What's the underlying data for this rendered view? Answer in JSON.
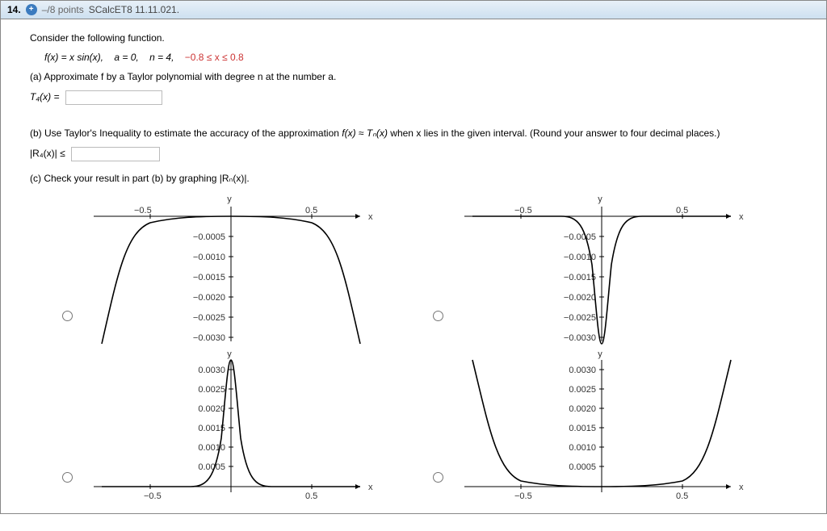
{
  "header": {
    "question_number": "14.",
    "points": "–/8 points",
    "source": "SCalcET8 11.11.021."
  },
  "intro": "Consider the following function.",
  "func": {
    "lhs": "f(x) = x sin(x),",
    "a": "a = 0,",
    "n": "n = 4,",
    "interval": "−0.8 ≤ x ≤ 0.8"
  },
  "part_a": {
    "prompt": "(a) Approximate f by a Taylor polynomial with degree n at the number a.",
    "lhs": "T₄(x) ="
  },
  "part_b": {
    "prompt_pre": "(b) Use Taylor's Inequality to estimate the accuracy of the approximation ",
    "approx": "f(x) ≈ Tₙ(x)",
    "prompt_mid": " when x lies in the given interval. (Round your answer to four decimal places.)",
    "lhs": "|R₄(x)| ≤"
  },
  "part_c": {
    "prompt": "(c) Check your result in part (b) by graphing  |Rₙ(x)|."
  },
  "axis_labels": {
    "x": "x",
    "y": "y"
  },
  "plotA": {
    "x_ticks": [
      "−0.5",
      "0.5"
    ],
    "y_ticks": [
      "−0.0005",
      "−0.0010",
      "−0.0015",
      "−0.0020",
      "−0.0025",
      "−0.0030"
    ]
  },
  "plotB": {
    "x_ticks": [
      "−0.5",
      "0.5"
    ],
    "y_ticks": [
      "−0.0005",
      "−0.0010",
      "−0.0015",
      "−0.0020",
      "−0.0025",
      "−0.0030"
    ]
  },
  "plotC": {
    "x_ticks": [
      "−0.5",
      "0.5"
    ],
    "y_ticks": [
      "0.0030",
      "0.0025",
      "0.0020",
      "0.0015",
      "0.0010",
      "0.0005"
    ]
  },
  "plotD": {
    "x_ticks": [
      "−0.5",
      "0.5"
    ],
    "y_ticks": [
      "0.0030",
      "0.0025",
      "0.0020",
      "0.0015",
      "0.0010",
      "0.0005"
    ]
  },
  "chart_data": [
    {
      "type": "line",
      "title": "Option A",
      "xlabel": "x",
      "ylabel": "y",
      "xlim": [
        -0.8,
        0.8
      ],
      "ylim": [
        -0.0033,
        0.0002
      ],
      "x": [
        -0.8,
        -0.7,
        -0.6,
        -0.5,
        -0.4,
        -0.3,
        -0.2,
        -0.1,
        0,
        0.1,
        0.2,
        0.3,
        0.4,
        0.5,
        0.6,
        0.7,
        0.8
      ],
      "y": [
        -0.0031,
        -0.0014,
        -0.00055,
        -0.00017,
        -4e-05,
        -5e-06,
        0,
        0,
        0,
        0,
        0,
        -5e-06,
        -4e-05,
        -0.00017,
        -0.00055,
        -0.0014,
        -0.0031
      ]
    },
    {
      "type": "line",
      "title": "Option B",
      "xlabel": "x",
      "ylabel": "y",
      "xlim": [
        -0.8,
        0.8
      ],
      "ylim": [
        -0.0033,
        0.0002
      ],
      "x": [
        -0.8,
        -0.6,
        -0.4,
        -0.2,
        -0.1,
        -0.05,
        0,
        0.05,
        0.1,
        0.2,
        0.4,
        0.6,
        0.8
      ],
      "y": [
        0,
        0,
        0,
        -0.00015,
        -0.0008,
        -0.0022,
        -0.0033,
        -0.0022,
        -0.0008,
        -0.00015,
        0,
        0,
        0
      ]
    },
    {
      "type": "line",
      "title": "Option C",
      "xlabel": "x",
      "ylabel": "y",
      "xlim": [
        -0.8,
        0.8
      ],
      "ylim": [
        -0.0002,
        0.0033
      ],
      "x": [
        -0.8,
        -0.6,
        -0.4,
        -0.2,
        -0.1,
        -0.05,
        0,
        0.05,
        0.1,
        0.2,
        0.4,
        0.6,
        0.8
      ],
      "y": [
        0,
        0,
        0,
        0.00015,
        0.0008,
        0.0022,
        0.0033,
        0.0022,
        0.0008,
        0.00015,
        0,
        0,
        0
      ]
    },
    {
      "type": "line",
      "title": "Option D",
      "xlabel": "x",
      "ylabel": "y",
      "xlim": [
        -0.8,
        0.8
      ],
      "ylim": [
        -0.0002,
        0.0033
      ],
      "x": [
        -0.8,
        -0.7,
        -0.6,
        -0.5,
        -0.4,
        -0.3,
        -0.2,
        -0.1,
        0,
        0.1,
        0.2,
        0.3,
        0.4,
        0.5,
        0.6,
        0.7,
        0.8
      ],
      "y": [
        0.0031,
        0.0014,
        0.00055,
        0.00017,
        4e-05,
        5e-06,
        0,
        0,
        0,
        0,
        0,
        5e-06,
        4e-05,
        0.00017,
        0.00055,
        0.0014,
        0.0031
      ]
    }
  ]
}
